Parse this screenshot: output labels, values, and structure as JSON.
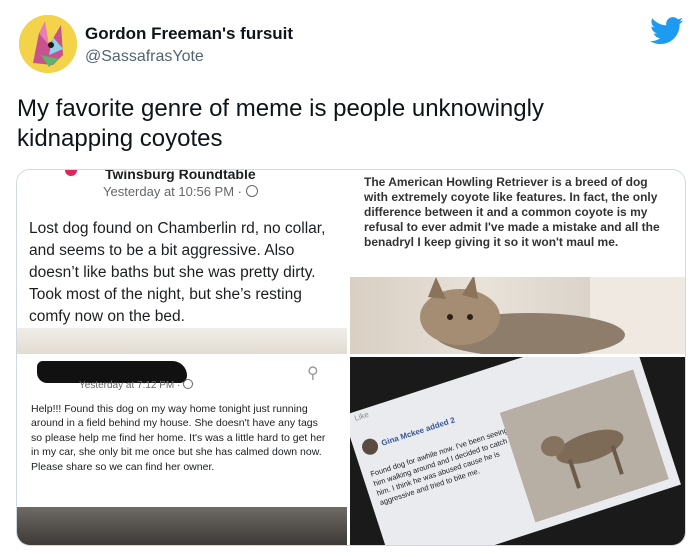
{
  "tweet": {
    "display_name": "Gordon Freeman's fursuit",
    "handle": "@SassafrasYote",
    "text": "My favorite genre of meme is people unknowingly kidnapping coyotes"
  },
  "panels": {
    "p1": {
      "group": "Twinsburg Roundtable",
      "time": "Yesterday at 10:56 PM ·",
      "post": "Lost dog found on Chamberlin rd, no collar, and seems to be a bit aggressive. Also doesn’t like baths but she was pretty dirty. Took most of the night, but she’s resting comfy now on the bed."
    },
    "p2": {
      "post": "The American Howling Retriever is a breed of dog with extremely coyote like features. In fact, the only difference between it and a common coyote is my refusal to ever admit I've made a mistake and all the benadryl I keep giving it so it won't maul me."
    },
    "p3": {
      "time": "Yesterday at 7:12 PM ·",
      "post": "Help!!! Found this dog on my way home tonight just running around in a field behind my house. She doesn't have any tags so please help me find her home. It's was a little hard to get her in my car, she only bit me once but she has calmed down now. Please share so we can find her owner."
    },
    "p4": {
      "like": "Like",
      "name": "Gina Mckee added 2",
      "post": "Found dog for awhile now. I've been seeing him walking around and I decided to catch him. I think he was abused cause he is aggressive and tried to bite me."
    }
  },
  "colors": {
    "twitter_blue": "#1d9bf0",
    "handle_gray": "#536471",
    "border": "#cfd9de"
  },
  "icons": [
    "twitter-bird-icon",
    "globe-icon",
    "add-friend-icon"
  ]
}
